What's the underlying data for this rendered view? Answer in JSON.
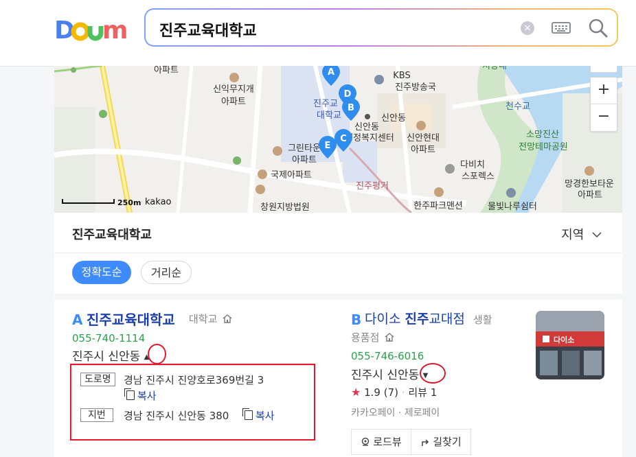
{
  "header": {
    "logo_text": "Daum",
    "search_value": "진주교육대학교",
    "icons": [
      "clear-icon",
      "keyboard-icon",
      "search-icon"
    ]
  },
  "map": {
    "labels": {
      "apt1": "아파트",
      "sinik": "신익무지개",
      "sinik2": "아파트",
      "kbs": "KBS",
      "kbs2": "진주방송국",
      "edu": "진주교",
      "edu2": "대학교",
      "sinan": "신안동",
      "welfare1": "신안동",
      "welfare2": "행정복지센터",
      "sinanhd1": "신안현대",
      "sinanhd2": "아파트",
      "green1": "그린타운",
      "green2": "아파트",
      "intl": "국제아파트",
      "davinci1": "다비치",
      "davinci2": "스포렉스",
      "jinjupg": "진주평거",
      "court": "창원지방법원",
      "hanju": "한주파크맨션",
      "mulbit": "물빛나루쉼터",
      "chunsu": "천수교",
      "somang1": "소망진산",
      "somang2": "전망테마공원",
      "manggyeong1": "망경한보타운",
      "manggyeong2": "아파트",
      "top_right": "지방내"
    },
    "scale": "250m",
    "brand": "kakao",
    "markers": [
      "A",
      "B",
      "C",
      "D",
      "E"
    ],
    "zoom_in": "+",
    "zoom_out": "−"
  },
  "panel": {
    "title": "진주교육대학교",
    "region_label": "지역",
    "sort_options": [
      "정확도순",
      "거리순"
    ],
    "sort_selected": "정확도순"
  },
  "results": [
    {
      "letter": "A",
      "name": "진주교육대학교",
      "category": "대학교",
      "phone": "055-740-1114",
      "address_short": "진주시 신안동",
      "road_label": "도로명",
      "road_address": "경남 진주시 진양호로369번길 3",
      "jibun_label": "지번",
      "jibun_address": "경남 진주시 신안동 380",
      "copy_label": "복사"
    },
    {
      "letter": "B",
      "name_prefix": "다이소 ",
      "name_bold": "진주",
      "name_suffix": "교대점",
      "category1": "생활",
      "category2": "용품점",
      "phone": "055-746-6016",
      "address_short": "진주시 신안동",
      "rating": "1.9",
      "rating_count": "(7)",
      "review": "리뷰 1",
      "pay_kakao": "카카오페이",
      "pay_zero": "제로페이",
      "roadview": "로드뷰",
      "directions": "길찾기",
      "thumb_sign": "다이소"
    }
  ],
  "colors": {
    "accent": "#3e8bff",
    "link": "#1a3fa8",
    "phone": "#2ba14b",
    "highlight": "#e3182a",
    "star": "#e8344e"
  }
}
